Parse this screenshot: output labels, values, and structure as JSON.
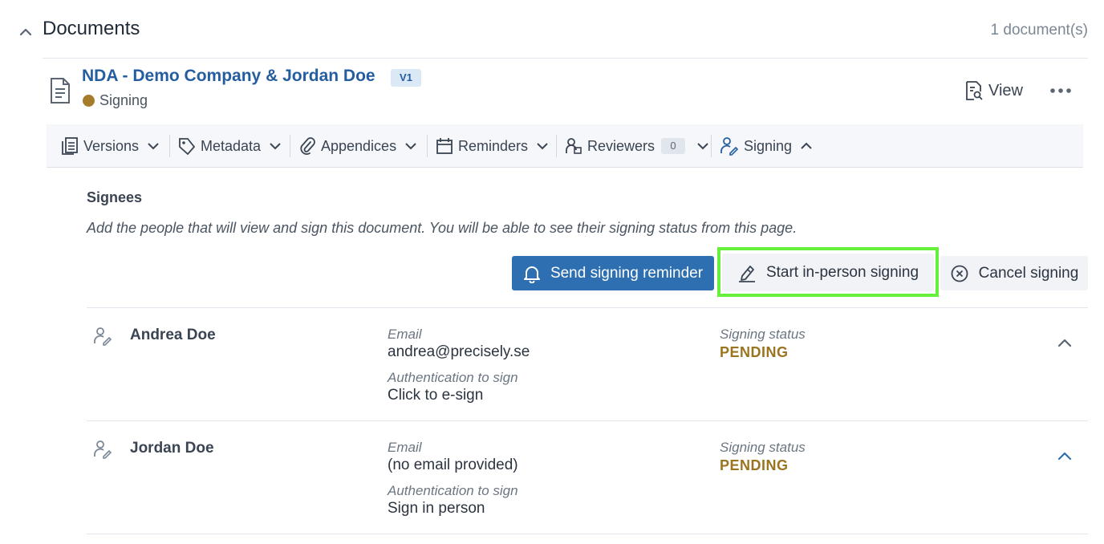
{
  "section": {
    "title": "Documents",
    "count": "1 document(s)"
  },
  "document": {
    "title": "NDA - Demo Company & Jordan Doe",
    "version": "V1",
    "status": "Signing",
    "status_color": "#a67c2a",
    "view_label": "View"
  },
  "tabs": [
    {
      "label": "Versions",
      "icon": "versions-icon"
    },
    {
      "label": "Metadata",
      "icon": "tag-icon"
    },
    {
      "label": "Appendices",
      "icon": "paperclip-icon"
    },
    {
      "label": "Reminders",
      "icon": "calendar-icon"
    },
    {
      "label": "Reviewers",
      "icon": "reviewer-icon",
      "count": "0"
    },
    {
      "label": "Signing",
      "icon": "signing-icon",
      "active": true
    }
  ],
  "signing": {
    "heading": "Signees",
    "description": "Add the people that will view and sign this document. You will be able to see their signing status from this page.",
    "send_reminder_label": "Send signing reminder",
    "start_in_person_label": "Start in-person signing",
    "cancel_label": "Cancel signing"
  },
  "signees": [
    {
      "name": "Andrea Doe",
      "email_label": "Email",
      "email": "andrea@precisely.se",
      "auth_label": "Authentication to sign",
      "auth": "Click to e-sign",
      "status_label": "Signing status",
      "status": "PENDING"
    },
    {
      "name": "Jordan Doe",
      "email_label": "Email",
      "email": "(no email provided)",
      "auth_label": "Authentication to sign",
      "auth": "Sign in person",
      "status_label": "Signing status",
      "status": "PENDING"
    }
  ],
  "colors": {
    "accent": "#2d6fb0",
    "title_blue": "#245da0",
    "pending": "#9a741f",
    "highlight": "#66f03c"
  }
}
